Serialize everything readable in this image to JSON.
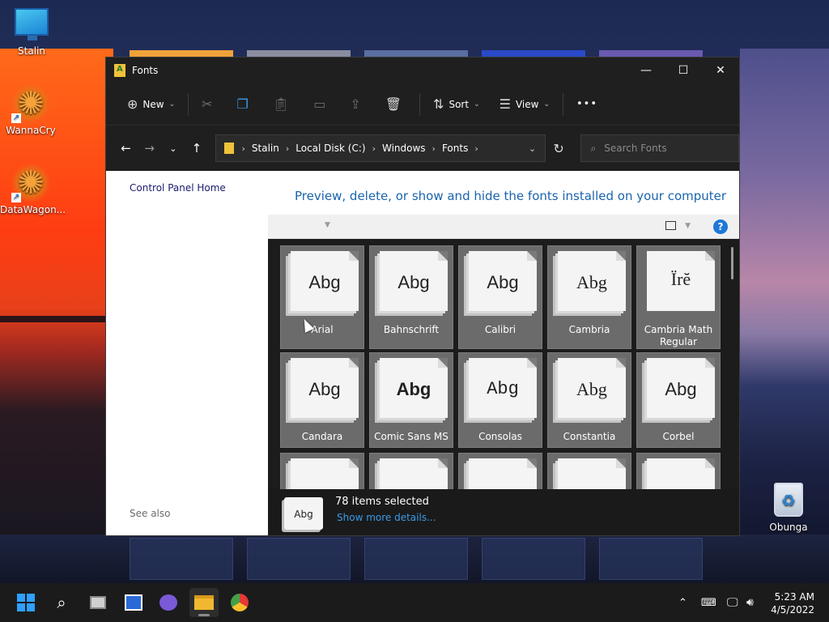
{
  "desktop": {
    "icons": [
      {
        "label": "Stalin",
        "icon": "monitor-icon"
      },
      {
        "label": "WannaCry",
        "icon": "orange-star-icon"
      },
      {
        "label": "DataWagon...",
        "icon": "orange-star-icon"
      },
      {
        "label": "Obunga",
        "icon": "recycle-bin-icon"
      }
    ]
  },
  "window": {
    "title": "Fonts",
    "title_icon": "fonts-folder-icon",
    "controls": {
      "minimize": "—",
      "maximize": "☐",
      "close": "✕"
    },
    "commandbar": {
      "new_label": "New",
      "sort_label": "Sort",
      "view_label": "View",
      "more": "•••"
    },
    "address": {
      "crumbs": [
        "Stalin",
        "Local Disk (C:)",
        "Windows",
        "Fonts"
      ],
      "search_placeholder": "Search Fonts"
    },
    "left_pane": {
      "home_link": "Control Panel Home",
      "see_also": "See also"
    },
    "heading": "Preview, delete, or show and hide the fonts installed on your computer",
    "help": "?",
    "fonts": [
      {
        "name": "Arial",
        "sample": "Abg"
      },
      {
        "name": "Bahnschrift",
        "sample": "Abg"
      },
      {
        "name": "Calibri",
        "sample": "Abg"
      },
      {
        "name": "Cambria",
        "sample": "Abg"
      },
      {
        "name": "Cambria Math Regular",
        "sample": "Ïrĕ"
      },
      {
        "name": "Candara",
        "sample": "Abg"
      },
      {
        "name": "Comic Sans MS",
        "sample": "Abg"
      },
      {
        "name": "Consolas",
        "sample": "Abg"
      },
      {
        "name": "Constantia",
        "sample": "Abg"
      },
      {
        "name": "Corbel",
        "sample": "Abg"
      }
    ],
    "details": {
      "icon_sample": "Abg",
      "count": "78 items selected",
      "more": "Show more details..."
    }
  },
  "taskbar": {
    "apps": [
      "start-icon",
      "search-icon",
      "task-view-icon",
      "widgets-icon",
      "chat-icon",
      "file-explorer-icon",
      "chrome-icon"
    ],
    "clock": {
      "time": "5:23 AM",
      "date": "4/5/2022"
    },
    "accent": "#2ea0ff"
  }
}
